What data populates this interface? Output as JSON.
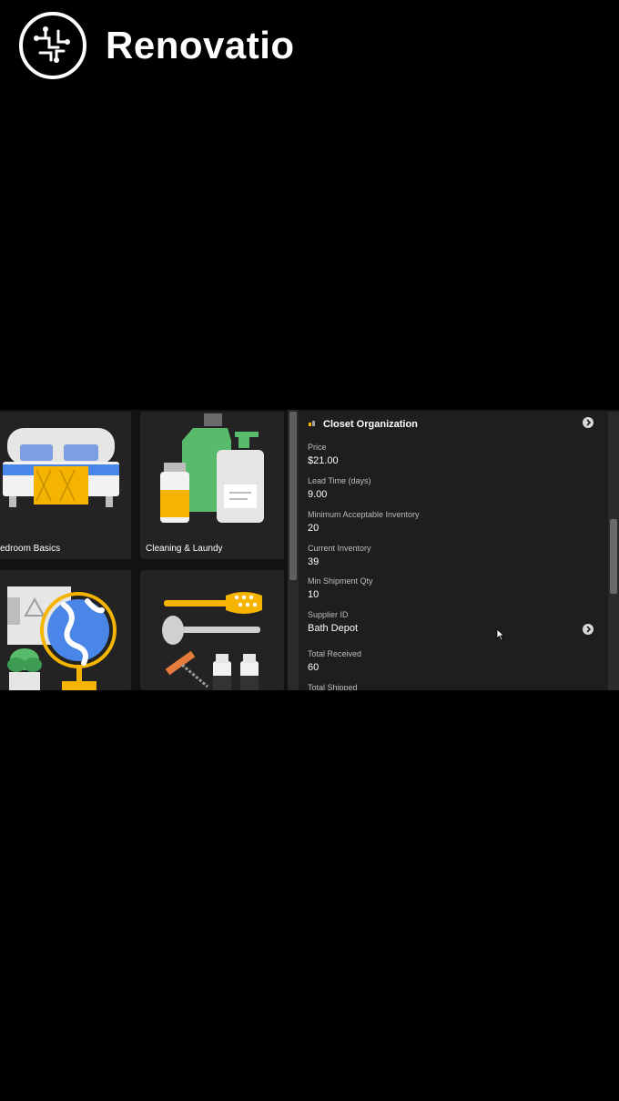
{
  "brand": {
    "name": "Renovatio"
  },
  "categories": [
    {
      "label": "edroom Basics"
    },
    {
      "label": "Cleaning & Laundy"
    },
    {
      "label": ""
    },
    {
      "label": ""
    }
  ],
  "detail": {
    "title": "Closet Organization",
    "fields": [
      {
        "label": "Price",
        "value": "$21.00"
      },
      {
        "label": "Lead Time (days)",
        "value": "9.00"
      },
      {
        "label": "Minimum Acceptable Inventory",
        "value": "20"
      },
      {
        "label": "Current Inventory",
        "value": "39"
      },
      {
        "label": "Min Shipment Qty",
        "value": "10"
      },
      {
        "label": "Supplier ID",
        "value": "Bath Depot"
      },
      {
        "label": "Total Received",
        "value": "60"
      },
      {
        "label": "Total Shipped",
        "value": ""
      }
    ]
  },
  "colors": {
    "background": "#000000",
    "panel": "#1e1e1e",
    "tile": "#232323",
    "accent_yellow": "#f4b400",
    "accent_blue": "#4a86e8",
    "accent_green": "#5cb85c"
  }
}
